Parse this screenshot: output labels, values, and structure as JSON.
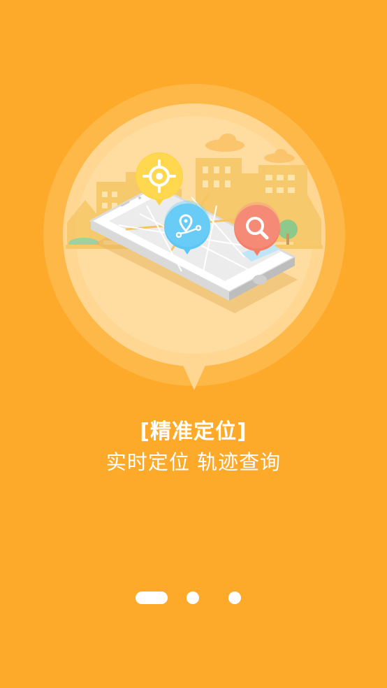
{
  "onboarding": {
    "title": "[精准定位]",
    "subtitle": "实时定位 轨迹查询",
    "pages": 3,
    "current_page": 1
  },
  "illustration": {
    "icons": [
      "locate-target-icon",
      "route-pin-icon",
      "search-icon"
    ]
  },
  "colors": {
    "background": "#FDAA2A",
    "pin_locate": "#FFD23F",
    "pin_route": "#5CC6F4",
    "pin_search": "#F4806A",
    "text": "#FFFFFF"
  }
}
